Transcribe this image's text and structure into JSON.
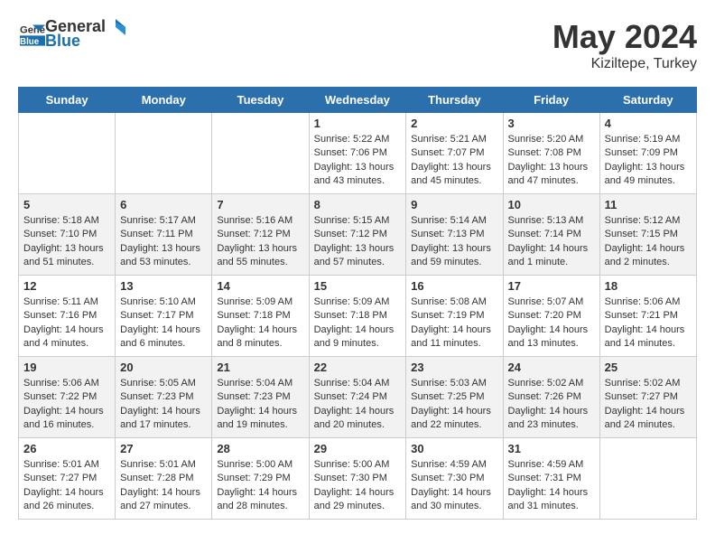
{
  "header": {
    "logo_general": "General",
    "logo_blue": "Blue",
    "month_year": "May 2024",
    "location": "Kiziltepe, Turkey"
  },
  "weekdays": [
    "Sunday",
    "Monday",
    "Tuesday",
    "Wednesday",
    "Thursday",
    "Friday",
    "Saturday"
  ],
  "weeks": [
    [
      {
        "day": "",
        "sunrise": "",
        "sunset": "",
        "daylight": ""
      },
      {
        "day": "",
        "sunrise": "",
        "sunset": "",
        "daylight": ""
      },
      {
        "day": "",
        "sunrise": "",
        "sunset": "",
        "daylight": ""
      },
      {
        "day": "1",
        "sunrise": "Sunrise: 5:22 AM",
        "sunset": "Sunset: 7:06 PM",
        "daylight": "Daylight: 13 hours and 43 minutes."
      },
      {
        "day": "2",
        "sunrise": "Sunrise: 5:21 AM",
        "sunset": "Sunset: 7:07 PM",
        "daylight": "Daylight: 13 hours and 45 minutes."
      },
      {
        "day": "3",
        "sunrise": "Sunrise: 5:20 AM",
        "sunset": "Sunset: 7:08 PM",
        "daylight": "Daylight: 13 hours and 47 minutes."
      },
      {
        "day": "4",
        "sunrise": "Sunrise: 5:19 AM",
        "sunset": "Sunset: 7:09 PM",
        "daylight": "Daylight: 13 hours and 49 minutes."
      }
    ],
    [
      {
        "day": "5",
        "sunrise": "Sunrise: 5:18 AM",
        "sunset": "Sunset: 7:10 PM",
        "daylight": "Daylight: 13 hours and 51 minutes."
      },
      {
        "day": "6",
        "sunrise": "Sunrise: 5:17 AM",
        "sunset": "Sunset: 7:11 PM",
        "daylight": "Daylight: 13 hours and 53 minutes."
      },
      {
        "day": "7",
        "sunrise": "Sunrise: 5:16 AM",
        "sunset": "Sunset: 7:12 PM",
        "daylight": "Daylight: 13 hours and 55 minutes."
      },
      {
        "day": "8",
        "sunrise": "Sunrise: 5:15 AM",
        "sunset": "Sunset: 7:12 PM",
        "daylight": "Daylight: 13 hours and 57 minutes."
      },
      {
        "day": "9",
        "sunrise": "Sunrise: 5:14 AM",
        "sunset": "Sunset: 7:13 PM",
        "daylight": "Daylight: 13 hours and 59 minutes."
      },
      {
        "day": "10",
        "sunrise": "Sunrise: 5:13 AM",
        "sunset": "Sunset: 7:14 PM",
        "daylight": "Daylight: 14 hours and 1 minute."
      },
      {
        "day": "11",
        "sunrise": "Sunrise: 5:12 AM",
        "sunset": "Sunset: 7:15 PM",
        "daylight": "Daylight: 14 hours and 2 minutes."
      }
    ],
    [
      {
        "day": "12",
        "sunrise": "Sunrise: 5:11 AM",
        "sunset": "Sunset: 7:16 PM",
        "daylight": "Daylight: 14 hours and 4 minutes."
      },
      {
        "day": "13",
        "sunrise": "Sunrise: 5:10 AM",
        "sunset": "Sunset: 7:17 PM",
        "daylight": "Daylight: 14 hours and 6 minutes."
      },
      {
        "day": "14",
        "sunrise": "Sunrise: 5:09 AM",
        "sunset": "Sunset: 7:18 PM",
        "daylight": "Daylight: 14 hours and 8 minutes."
      },
      {
        "day": "15",
        "sunrise": "Sunrise: 5:09 AM",
        "sunset": "Sunset: 7:18 PM",
        "daylight": "Daylight: 14 hours and 9 minutes."
      },
      {
        "day": "16",
        "sunrise": "Sunrise: 5:08 AM",
        "sunset": "Sunset: 7:19 PM",
        "daylight": "Daylight: 14 hours and 11 minutes."
      },
      {
        "day": "17",
        "sunrise": "Sunrise: 5:07 AM",
        "sunset": "Sunset: 7:20 PM",
        "daylight": "Daylight: 14 hours and 13 minutes."
      },
      {
        "day": "18",
        "sunrise": "Sunrise: 5:06 AM",
        "sunset": "Sunset: 7:21 PM",
        "daylight": "Daylight: 14 hours and 14 minutes."
      }
    ],
    [
      {
        "day": "19",
        "sunrise": "Sunrise: 5:06 AM",
        "sunset": "Sunset: 7:22 PM",
        "daylight": "Daylight: 14 hours and 16 minutes."
      },
      {
        "day": "20",
        "sunrise": "Sunrise: 5:05 AM",
        "sunset": "Sunset: 7:23 PM",
        "daylight": "Daylight: 14 hours and 17 minutes."
      },
      {
        "day": "21",
        "sunrise": "Sunrise: 5:04 AM",
        "sunset": "Sunset: 7:23 PM",
        "daylight": "Daylight: 14 hours and 19 minutes."
      },
      {
        "day": "22",
        "sunrise": "Sunrise: 5:04 AM",
        "sunset": "Sunset: 7:24 PM",
        "daylight": "Daylight: 14 hours and 20 minutes."
      },
      {
        "day": "23",
        "sunrise": "Sunrise: 5:03 AM",
        "sunset": "Sunset: 7:25 PM",
        "daylight": "Daylight: 14 hours and 22 minutes."
      },
      {
        "day": "24",
        "sunrise": "Sunrise: 5:02 AM",
        "sunset": "Sunset: 7:26 PM",
        "daylight": "Daylight: 14 hours and 23 minutes."
      },
      {
        "day": "25",
        "sunrise": "Sunrise: 5:02 AM",
        "sunset": "Sunset: 7:27 PM",
        "daylight": "Daylight: 14 hours and 24 minutes."
      }
    ],
    [
      {
        "day": "26",
        "sunrise": "Sunrise: 5:01 AM",
        "sunset": "Sunset: 7:27 PM",
        "daylight": "Daylight: 14 hours and 26 minutes."
      },
      {
        "day": "27",
        "sunrise": "Sunrise: 5:01 AM",
        "sunset": "Sunset: 7:28 PM",
        "daylight": "Daylight: 14 hours and 27 minutes."
      },
      {
        "day": "28",
        "sunrise": "Sunrise: 5:00 AM",
        "sunset": "Sunset: 7:29 PM",
        "daylight": "Daylight: 14 hours and 28 minutes."
      },
      {
        "day": "29",
        "sunrise": "Sunrise: 5:00 AM",
        "sunset": "Sunset: 7:30 PM",
        "daylight": "Daylight: 14 hours and 29 minutes."
      },
      {
        "day": "30",
        "sunrise": "Sunrise: 4:59 AM",
        "sunset": "Sunset: 7:30 PM",
        "daylight": "Daylight: 14 hours and 30 minutes."
      },
      {
        "day": "31",
        "sunrise": "Sunrise: 4:59 AM",
        "sunset": "Sunset: 7:31 PM",
        "daylight": "Daylight: 14 hours and 31 minutes."
      },
      {
        "day": "",
        "sunrise": "",
        "sunset": "",
        "daylight": ""
      }
    ]
  ]
}
